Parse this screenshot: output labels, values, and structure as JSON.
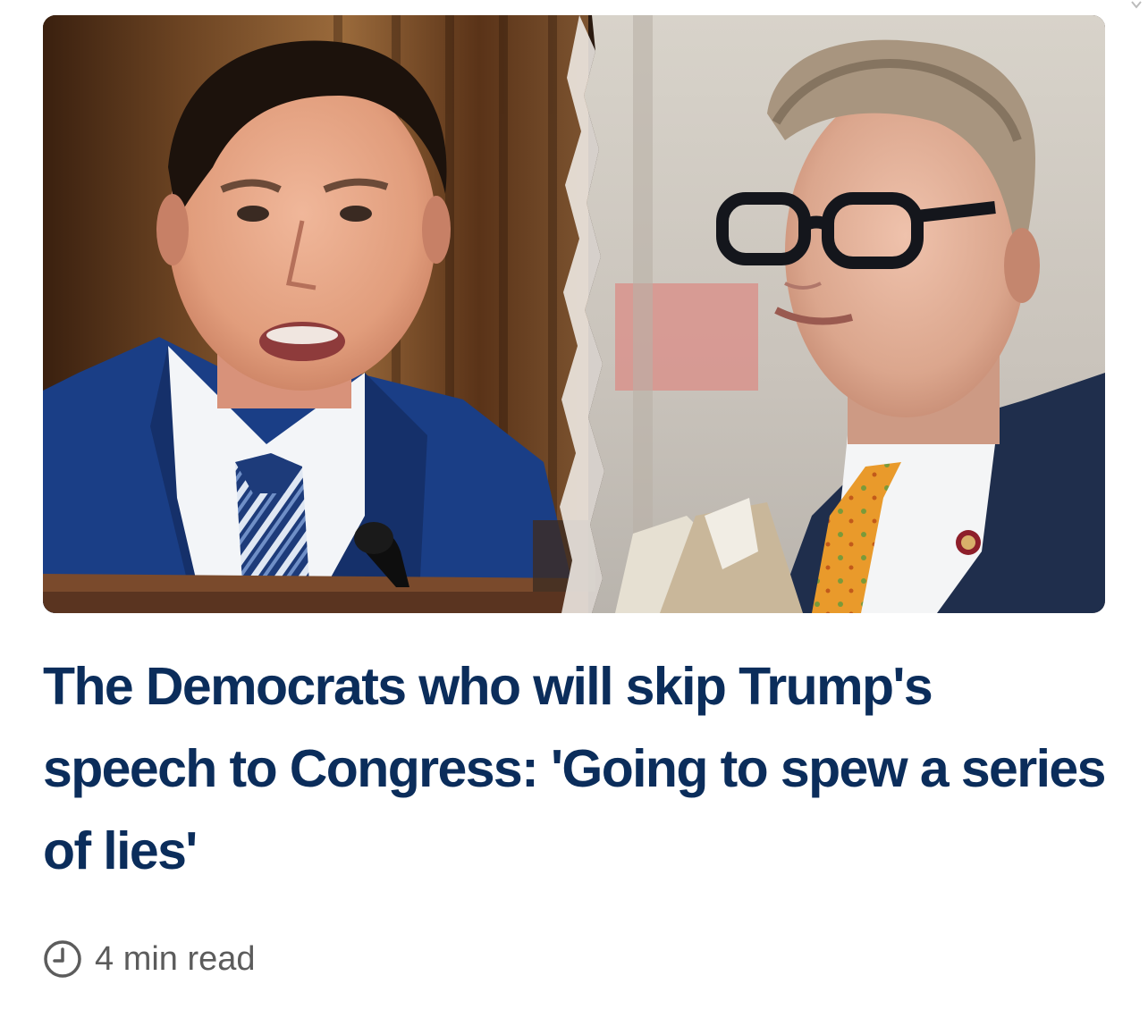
{
  "article": {
    "headline": "The Democrats who will skip Trump's speech to Congress: 'Going to spew a series of lies'",
    "read_time": "4 min read",
    "read_time_icon": "clock-icon",
    "image": {
      "left_panel": "photo",
      "right_panel": "photo"
    }
  },
  "colors": {
    "headline": "#0b2d5b",
    "meta_text": "#5c5c5c",
    "background": "#ffffff"
  }
}
